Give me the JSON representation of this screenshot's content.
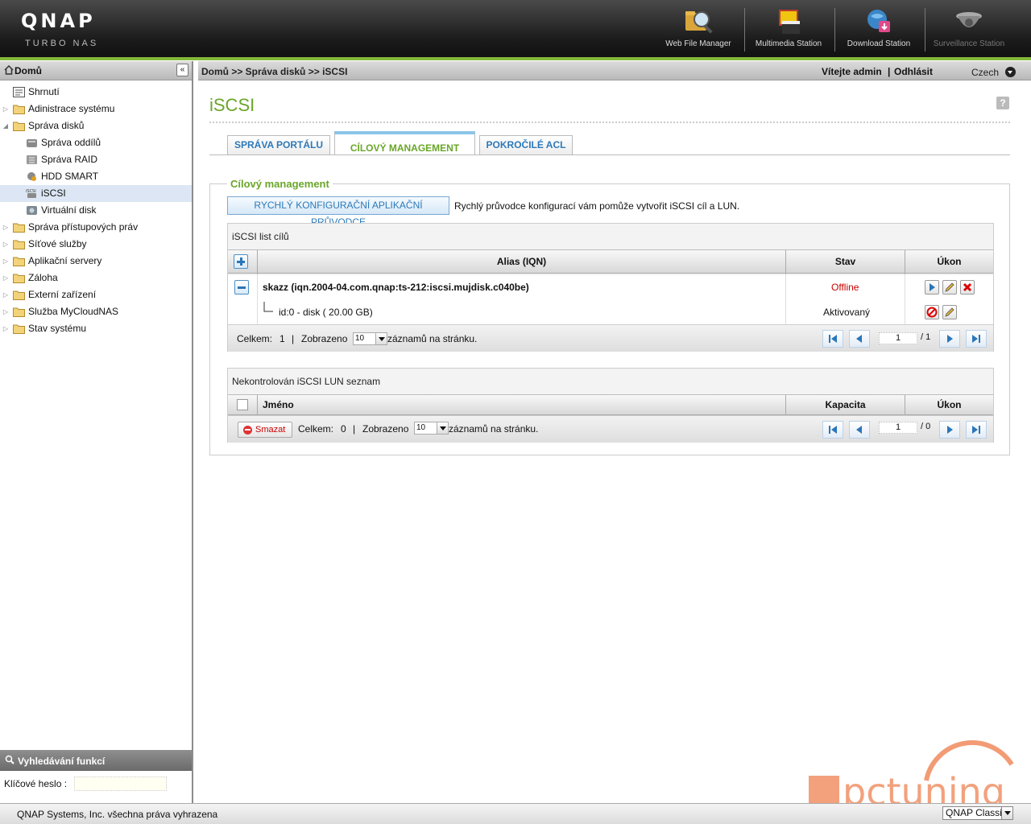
{
  "header": {
    "logo": "QNAP",
    "logo_sub": "Turbo NAS",
    "apps": [
      {
        "label": "Web File Manager",
        "icon": "web-file-manager-icon"
      },
      {
        "label": "Multimedia Station",
        "icon": "multimedia-station-icon"
      },
      {
        "label": "Download Station",
        "icon": "download-station-icon"
      },
      {
        "label": "Surveillance Station",
        "icon": "surveillance-station-icon"
      }
    ],
    "accent": "#84b93a"
  },
  "sidebar": {
    "title": "Domů",
    "collapse": "«",
    "items": [
      {
        "label": "Shrnutí"
      },
      {
        "label": "Adinistrace systému"
      },
      {
        "label": "Správa disků"
      },
      {
        "label": "Správa oddílů"
      },
      {
        "label": "Správa RAID"
      },
      {
        "label": "HDD SMART"
      },
      {
        "label": "iSCSI"
      },
      {
        "label": "Virtuální disk"
      },
      {
        "label": "Správa přístupových práv"
      },
      {
        "label": "Síťové služby"
      },
      {
        "label": "Aplikační servery"
      },
      {
        "label": "Záloha"
      },
      {
        "label": "Externí zařízení"
      },
      {
        "label": "Služba MyCloudNAS"
      },
      {
        "label": "Stav systému"
      }
    ],
    "selected": "iSCSI",
    "search_title": "Vyhledávání funkcí",
    "keyword_label": "Klíčové heslo :",
    "keyword_value": ""
  },
  "topbar": {
    "breadcrumb": "Domů >> Správa disků >> iSCSI",
    "welcome": "Vítejte admin",
    "separator": "|",
    "logout": "Odhlásit",
    "language": "Czech"
  },
  "page": {
    "title": "iSCSI",
    "help": "?",
    "tabs": [
      {
        "label": "SPRÁVA PORTÁLU"
      },
      {
        "label": "CÍLOVÝ MANAGEMENT"
      },
      {
        "label": "POKROČILÉ ACL"
      }
    ],
    "active_tab": "CÍLOVÝ MANAGEMENT",
    "section_title": "Cílový management",
    "wizard_button": "RYCHLÝ KONFIGURAČNÍ APLIKAČNÍ PRŮVODCE",
    "wizard_desc": "Rychlý průvodce konfigurací vám pomůže vytvořit iSCSI cíl a LUN."
  },
  "targets": {
    "title": "iSCSI list cílů",
    "columns": {
      "alias": "Alias (IQN)",
      "status": "Stav",
      "action": "Úkon"
    },
    "rows": [
      {
        "alias": "skazz (iqn.2004-04.com.qnap:ts-212:iscsi.mujdisk.c040be)",
        "status": "Offline",
        "status_color": "#cc0000"
      },
      {
        "alias": "id:0 - disk ( 20.00 GB)",
        "status": "Aktivovaný"
      }
    ],
    "footer": {
      "total_label": "Celkem:",
      "total": "1",
      "sep": "|",
      "shown_label": "Zobrazeno",
      "per_page": "10",
      "per_page_suffix": "záznamů na stránku.",
      "page": "1",
      "page_of": "/ 1"
    }
  },
  "luns": {
    "title": "Nekontrolován iSCSI LUN seznam",
    "columns": {
      "name": "Jméno",
      "capacity": "Kapacita",
      "action": "Úkon"
    },
    "footer": {
      "delete": "Smazat",
      "total_label": "Celkem:",
      "total": "0",
      "sep": "|",
      "shown_label": "Zobrazeno",
      "per_page": "10",
      "per_page_suffix": "záznamů na stránku.",
      "page": "1",
      "page_of": "/ 0"
    }
  },
  "statusbar": {
    "copyright": "QNAP Systems, Inc. všechna práva vyhrazena",
    "theme": "QNAP Classic"
  },
  "watermark": {
    "text": "pctuning",
    "color": "#f08a5d"
  }
}
